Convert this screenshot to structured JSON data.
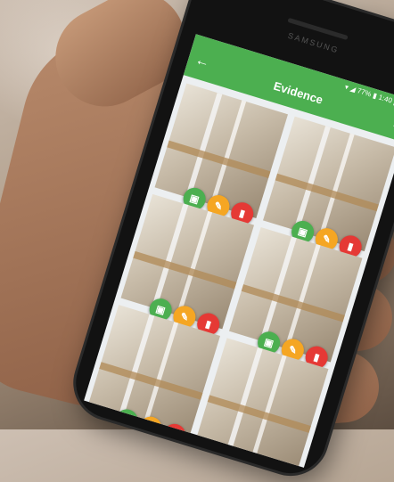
{
  "device": {
    "brand": "SAMSUNG"
  },
  "status_bar": {
    "battery": "77%",
    "time": "1:40 p.m."
  },
  "app_bar": {
    "title": "Evidence"
  },
  "colors": {
    "primary": "#4caf50",
    "approve": "#4caf50",
    "edit": "#f5a623",
    "delete": "#e53935"
  },
  "photos": [
    {
      "icons": [
        "image-icon",
        "edit-icon",
        "delete-icon"
      ]
    },
    {
      "icons": [
        "image-icon",
        "edit-icon",
        "delete-icon"
      ]
    },
    {
      "icons": [
        "image-icon",
        "edit-icon",
        "delete-icon"
      ]
    },
    {
      "icons": [
        "image-icon",
        "edit-icon",
        "delete-icon"
      ]
    },
    {
      "icons": [
        "image-icon",
        "edit-icon",
        "delete-icon"
      ]
    },
    {
      "icons": [
        "image-icon",
        "edit-icon",
        "delete-icon"
      ]
    }
  ]
}
